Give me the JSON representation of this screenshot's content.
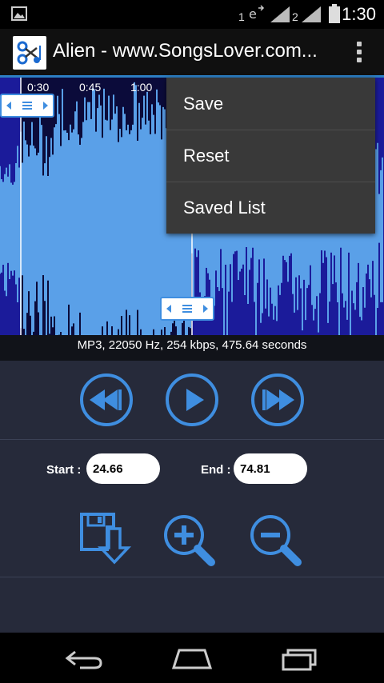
{
  "status_bar": {
    "time": "1:30",
    "sim1": "1",
    "sim2": "2"
  },
  "action_bar": {
    "title": "Alien - www.SongsLover.com..."
  },
  "waveform": {
    "ticks": [
      "0:30",
      "0:45",
      "1:00"
    ]
  },
  "menu": {
    "items": [
      {
        "label": "Save"
      },
      {
        "label": "Reset"
      },
      {
        "label": "Saved List"
      }
    ]
  },
  "info": {
    "text": "MP3, 22050 Hz, 254 kbps, 475.64 seconds"
  },
  "fields": {
    "start_label": "Start :",
    "start_value": "24.66",
    "end_label": "End :",
    "end_value": "74.81"
  },
  "icons": {
    "rewind": "rewind-icon",
    "play": "play-icon",
    "fast_forward": "fast-forward-icon",
    "save": "save-icon",
    "zoom_in": "zoom-in-icon",
    "zoom_out": "zoom-out-icon"
  },
  "colors": {
    "accent": "#3f8ee0",
    "waveform_bg": "#1b1b9a",
    "waveform_fg": "#5aa0e8",
    "controls_bg": "#262a3a"
  }
}
